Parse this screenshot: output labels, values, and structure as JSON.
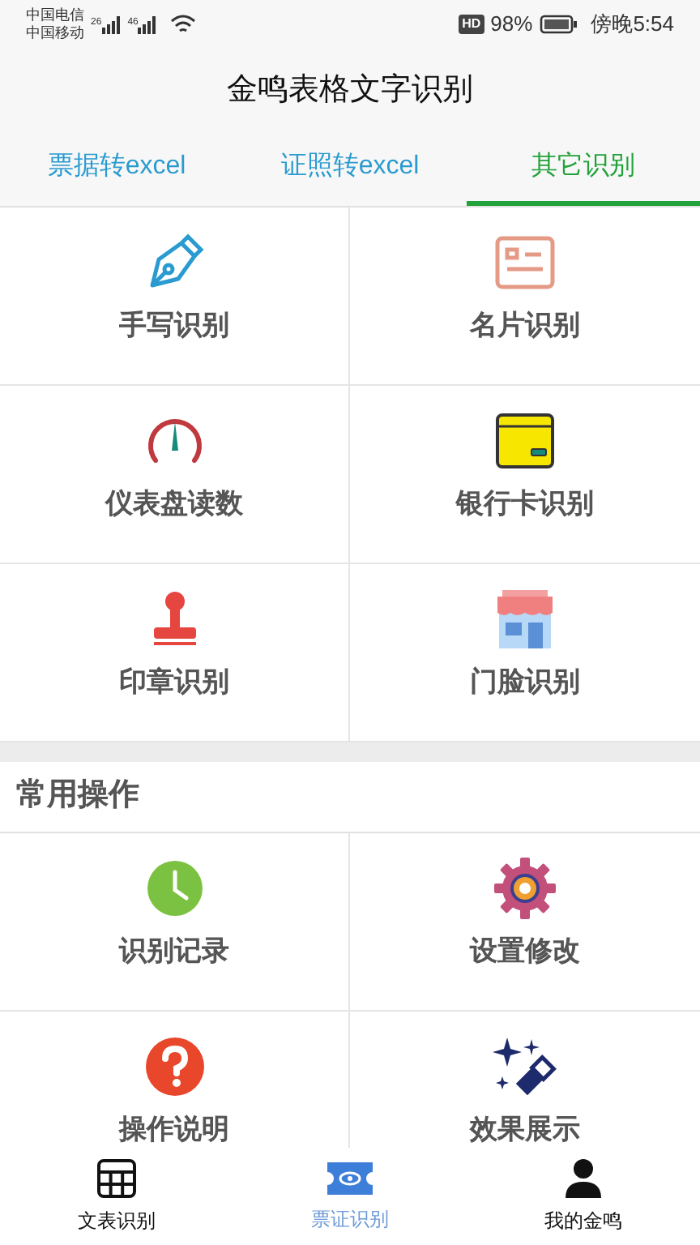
{
  "status_bar": {
    "carriers": [
      {
        "name": "中国电信",
        "network": "26"
      },
      {
        "name": "中国移动",
        "network": "46"
      }
    ],
    "hd": "HD",
    "battery": "98%",
    "time": "傍晚5:54"
  },
  "title": "金鸣表格文字识别",
  "tabs": [
    {
      "label": "票据转excel",
      "selected": false
    },
    {
      "label": "证照转excel",
      "selected": false
    },
    {
      "label": "其它识别",
      "selected": true
    }
  ],
  "recognition_items": [
    {
      "label": "手写识别"
    },
    {
      "label": "名片识别"
    },
    {
      "label": "仪表盘读数"
    },
    {
      "label": "银行卡识别"
    },
    {
      "label": "印章识别"
    },
    {
      "label": "门脸识别"
    }
  ],
  "common_section": {
    "title": "常用操作",
    "items": [
      {
        "label": "识别记录"
      },
      {
        "label": "设置修改"
      },
      {
        "label": "操作说明"
      },
      {
        "label": "效果展示"
      }
    ]
  },
  "bottom_nav": [
    {
      "label": "文表识别",
      "selected": false
    },
    {
      "label": "票证识别",
      "selected": true
    },
    {
      "label": "我的金鸣",
      "selected": false
    }
  ]
}
